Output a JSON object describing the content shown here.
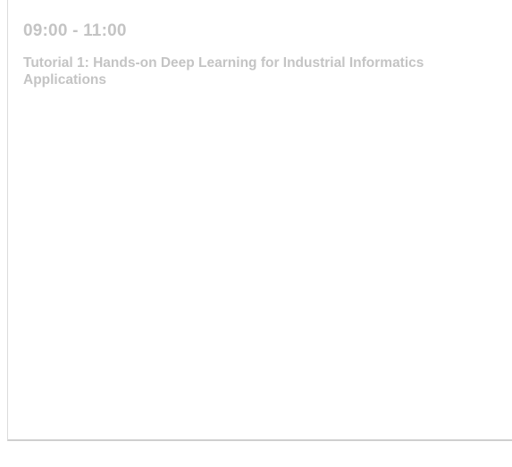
{
  "session": {
    "time_range": "09:00 - 11:00",
    "title": "Tutorial 1: Hands-on Deep Learning for Industrial Informatics Applications"
  }
}
